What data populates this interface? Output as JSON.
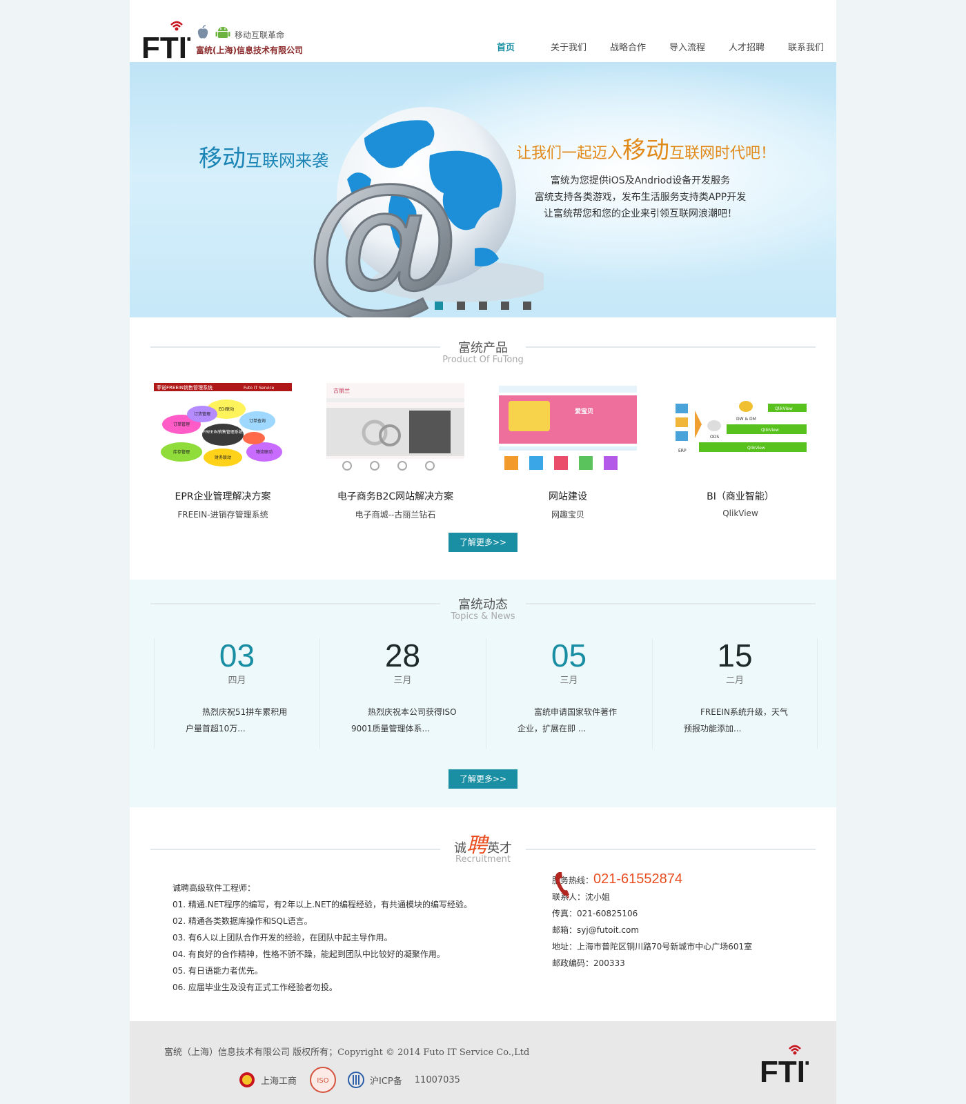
{
  "header": {
    "tagline": "移动互联革命",
    "company": "富统(上海)信息技术有限公司",
    "nav": [
      "首页",
      "关于我们",
      "战略合作",
      "导入流程",
      "人才招聘",
      "联系我们"
    ]
  },
  "banner": {
    "slogan_left_big": "移动",
    "slogan_left_rest": "互联网来袭",
    "slogan_right_pre": "让我们一起迈入",
    "slogan_right_big": "移动",
    "slogan_right_post": "互联网时代吧！",
    "lines": [
      "富统为您提供iOS及Andriod设备开发服务",
      "富统支持各类游戏，发布生活服务支持类APP开发",
      "让富统帮您和您的企业来引领互联网浪潮吧！"
    ],
    "at_symbol": "@",
    "slide_count": 5,
    "active_slide": 0
  },
  "products": {
    "title": "富统产品",
    "subtitle": "Product Of FuTong",
    "items": [
      {
        "title": "EPR企业管理解决方案",
        "sub": "FREEIN-进销存管理系统"
      },
      {
        "title": "电子商务B2C网站解决方案",
        "sub": "电子商城--古丽兰钻石"
      },
      {
        "title": "网站建设",
        "sub": "网趣宝贝"
      },
      {
        "title": "BI（商业智能）",
        "sub": "QlikView"
      }
    ],
    "thumb_text": {
      "erp_banner": "菲诺FREEIN销售管理系统",
      "erp_brand": "Futo IT Service",
      "erp_center": "FREEIN销售管理系统",
      "erp_bubbles": [
        "订单管理",
        "订货管理",
        "库存管理",
        "EDI联动",
        "财务联动",
        "物流联动",
        "订单查询"
      ],
      "shop_brand": "古丽兰",
      "web_brand": "爱宝贝",
      "bi_labels": [
        "DW & DM",
        "QlikView",
        "QlikView",
        "QlikView",
        "ODS",
        "ERP"
      ]
    },
    "more": "了解更多>>"
  },
  "news": {
    "title": "富统动态",
    "subtitle": "Topics & News",
    "items": [
      {
        "day": "03",
        "month": "四月",
        "text": "热烈庆祝51拼车累积用户量首超10万..."
      },
      {
        "day": "28",
        "month": "三月",
        "text": "热烈庆祝本公司获得ISO 9001质量管理体系..."
      },
      {
        "day": "05",
        "month": "三月",
        "text": "富统申请国家软件著作企业，扩展在即 ..."
      },
      {
        "day": "15",
        "month": "二月",
        "text": "FREEIN系统升级，天气预报功能添加..."
      }
    ],
    "more": "了解更多>>"
  },
  "recruit": {
    "title_pre": "诚",
    "title_hl": "聘",
    "title_post": "英才",
    "subtitle": "Recruitment",
    "intro": "诚聘高级软件工程师：",
    "requirements": [
      "01. 精通.NET程序的编写，有2年以上.NET的编程经验，有共通模块的编写经验。",
      "02. 精通各类数据库操作和SQL语言。",
      "03. 有6人以上团队合作开发的经验，在团队中起主导作用。",
      "04. 有良好的合作精神，性格不骄不躁，能起到团队中比较好的凝聚作用。",
      "05. 有日语能力者优先。",
      "06. 应届毕业生及没有正式工作经验者勿投。"
    ],
    "contact": {
      "hotline_label": "服务热线：",
      "hotline": "021-61552874",
      "person": "联系人：沈小姐",
      "fax": "传真：021-60825106",
      "email": "邮箱：syj@futoit.com",
      "address": "地址：上海市普陀区铜川路70号新城市中心广场601室",
      "postcode": "邮政编码：200333"
    }
  },
  "footer": {
    "copyright": "富统（上海）信息技术有限公司 版权所有；Copyright © 2014 Futo IT Service Co.,Ltd",
    "badge_gongshang": "上海工商",
    "badge_iso": "ISO",
    "badge_icp": "沪ICP备",
    "icp_number": "11007035"
  },
  "logo_text": "FTIT",
  "colors": {
    "accent": "#1a8fa3",
    "hotline": "#e84c1e",
    "orange": "#e18a1a",
    "logo_red": "#c8141e"
  }
}
